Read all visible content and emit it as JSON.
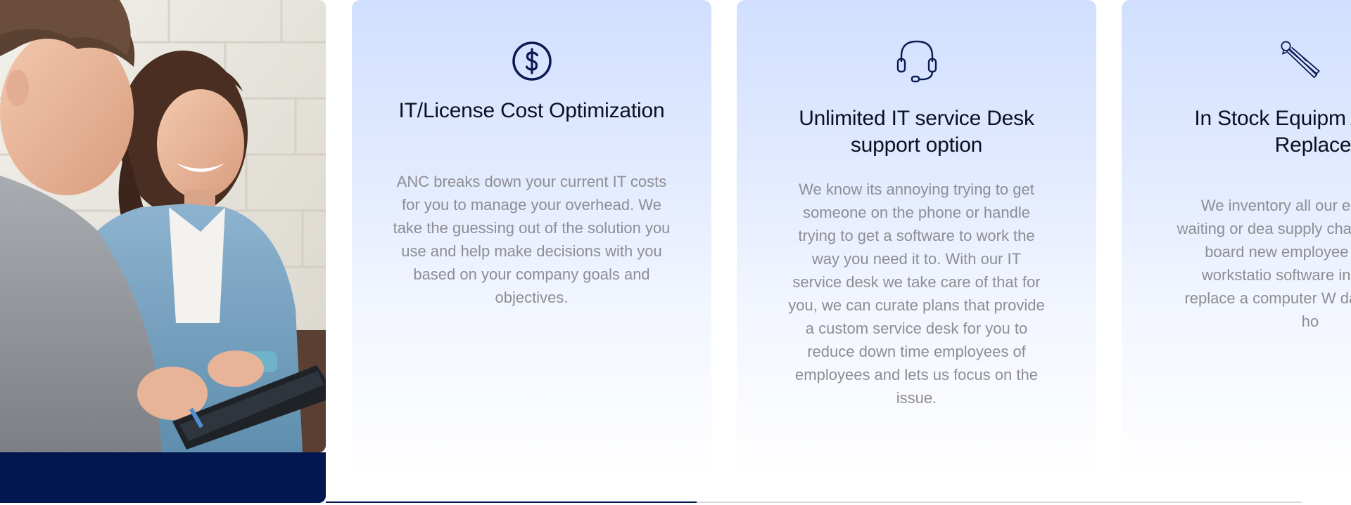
{
  "photo": {
    "alt": "Two colleagues smiling while working on a tablet"
  },
  "colors": {
    "accent": "#021650",
    "card_gradient_top": "#d1e0ff",
    "title": "#0b1020",
    "body_text": "#8e8e92"
  },
  "cards": [
    {
      "icon": "dollar-circle-icon",
      "title": "IT/License Cost Optimization",
      "description": "ANC breaks down your current IT costs for you to manage your overhead. We take the guessing out of the solution you use and help make decisions with you based on your company goals and objectives."
    },
    {
      "icon": "headset-icon",
      "title": "Unlimited IT service Desk support option",
      "description": "We know its annoying trying to get someone on the phone or handle trying to get a software to work the way you need it to. With our IT service desk we take care of that for you, we can curate plans that provide a custom service desk for you to reduce down time employees of employees and lets us focus on the issue."
    },
    {
      "icon": "pliers-icon",
      "title": "In Stock Equipm Advance Replace",
      "description": "We inventory all our ec no more waiting or dea supply chain issues. We board new employee complete workstatio software in 5 days or replace a computer W data within 24 ho"
    }
  ],
  "carousel": {
    "progress": 0.38
  }
}
